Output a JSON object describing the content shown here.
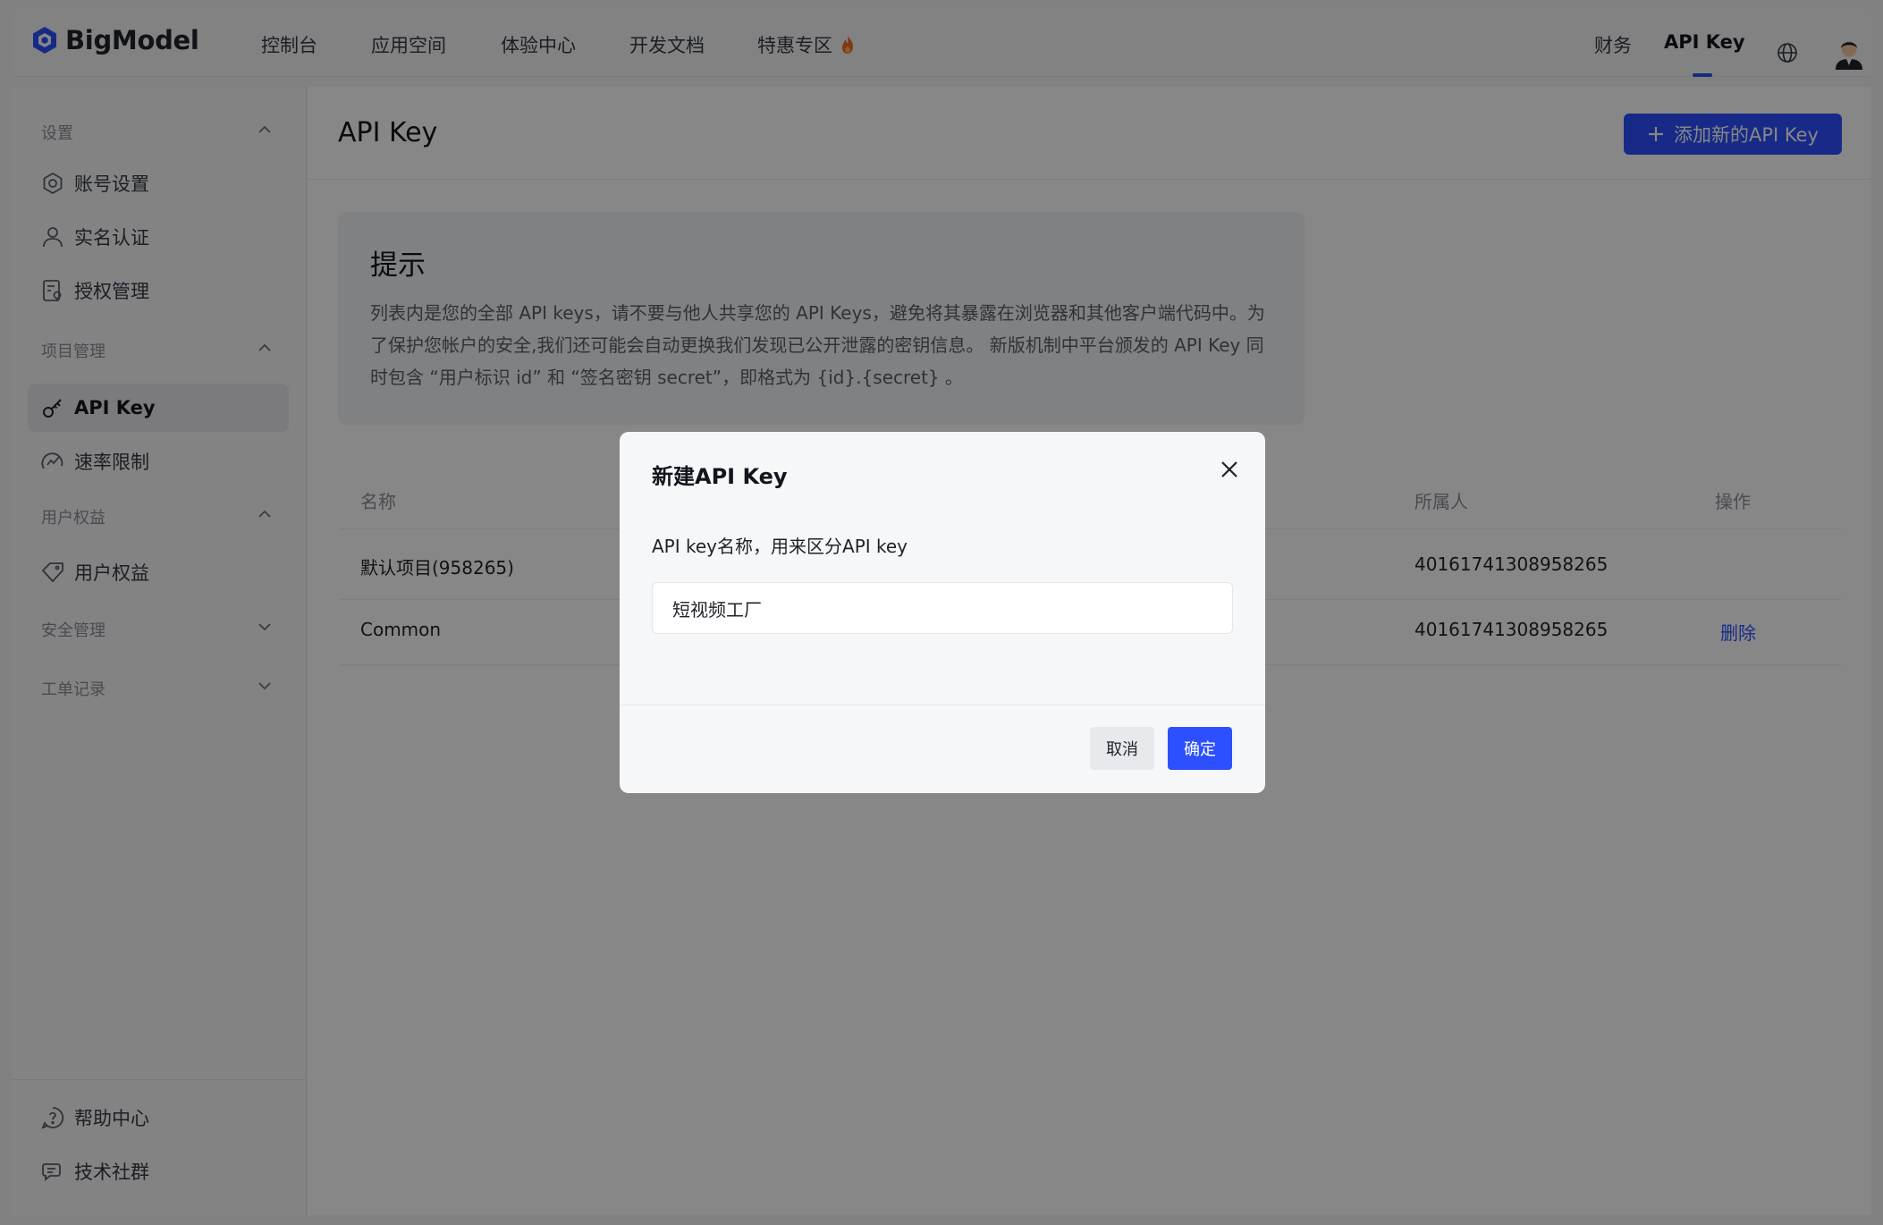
{
  "brand": {
    "name": "BigModel",
    "color": "#2d50ff"
  },
  "topnav": {
    "items": [
      {
        "label": "控制台"
      },
      {
        "label": "应用空间"
      },
      {
        "label": "体验中心"
      },
      {
        "label": "开发文档"
      },
      {
        "label": "特惠专区",
        "icon": "fire-icon"
      }
    ],
    "right": {
      "finance": "财务",
      "api_key": "API Key",
      "language_icon": "globe-icon",
      "avatar_icon": "avatar"
    }
  },
  "sidebar": {
    "groups": [
      {
        "label": "设置",
        "expanded": true,
        "items": [
          {
            "label": "账号设置",
            "icon": "settings-icon"
          },
          {
            "label": "实名认证",
            "icon": "user-icon"
          },
          {
            "label": "授权管理",
            "icon": "authorization-icon"
          }
        ]
      },
      {
        "label": "项目管理",
        "expanded": true,
        "items": [
          {
            "label": "API Key",
            "icon": "key-icon",
            "active": true
          },
          {
            "label": "速率限制",
            "icon": "speed-icon"
          }
        ]
      },
      {
        "label": "用户权益",
        "expanded": true,
        "items": [
          {
            "label": "用户权益",
            "icon": "benefit-icon"
          }
        ]
      },
      {
        "label": "安全管理",
        "expanded": false
      },
      {
        "label": "工单记录",
        "expanded": false
      }
    ],
    "footer": [
      {
        "label": "帮助中心",
        "icon": "help-icon"
      },
      {
        "label": "技术社群",
        "icon": "community-icon"
      }
    ]
  },
  "main": {
    "title": "API Key",
    "add_button": "添加新的API Key",
    "tip": {
      "title": "提示",
      "text": "列表内是您的全部 API keys，请不要与他人共享您的 API Keys，避免将其暴露在浏览器和其他客户端代码中。为了保护您帐户的安全,我们还可能会自动更换我们发现已公开泄露的密钥信息。 新版机制中平台颁发的 API Key 同时包含 “用户标识 id” 和 “签名密钥 secret”，即格式为 {id}.{secret} 。"
    },
    "table": {
      "headers": {
        "name": "名称",
        "owner": "所属人",
        "action": "操作"
      },
      "rows": [
        {
          "name": "默认项目(958265)",
          "owner": "40161741308958265",
          "action": ""
        },
        {
          "name": "Common",
          "owner": "40161741308958265",
          "action": "删除"
        }
      ]
    }
  },
  "dialog": {
    "title": "新建API Key",
    "label": "API key名称，用来区分API key",
    "input_value": "短视频工厂",
    "cancel": "取消",
    "confirm": "确定"
  }
}
